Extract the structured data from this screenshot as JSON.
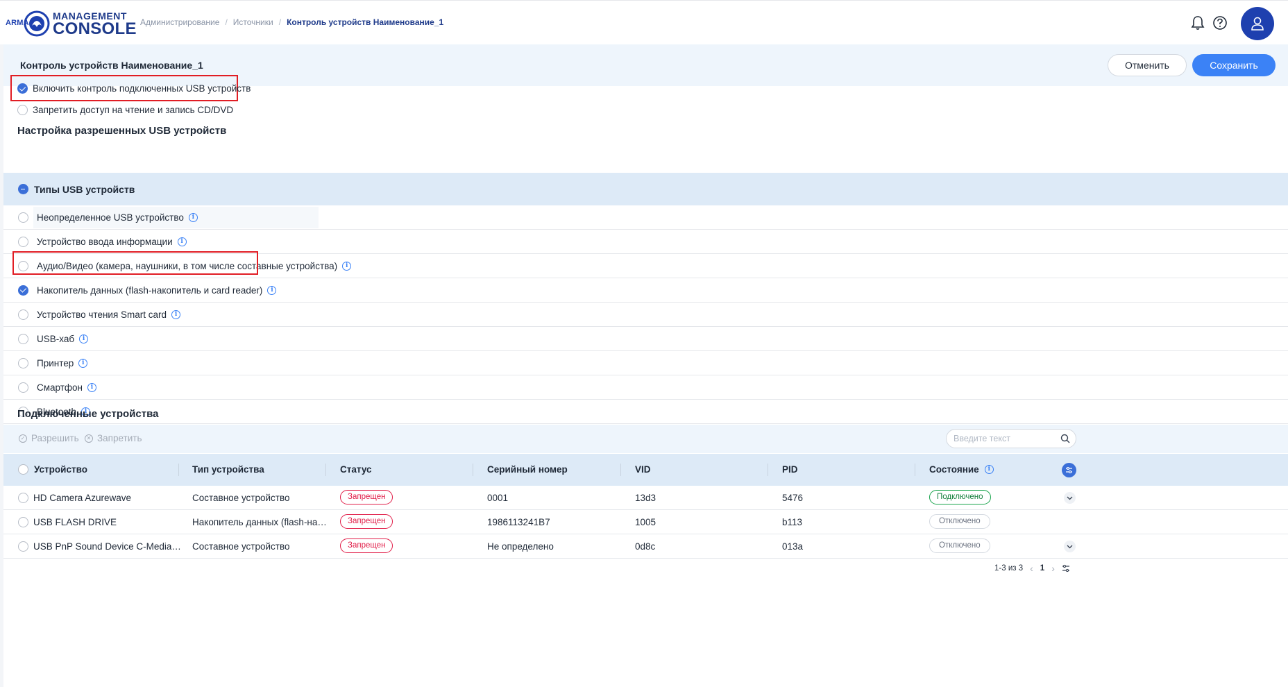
{
  "header": {
    "logo_arma": "ARMA",
    "logo_management": "MANAGEMENT",
    "logo_console": "CONSOLE",
    "breadcrumb": [
      "Администрирование",
      "Источники",
      "Контроль устройств Наименование_1"
    ]
  },
  "page": {
    "title": "Контроль устройств Наименование_1",
    "cancel_label": "Отменить",
    "save_label": "Сохранить"
  },
  "options": {
    "enable_usb_control": {
      "label": "Включить контроль подключенных USB устройств",
      "checked": true
    },
    "block_cd_dvd": {
      "label": "Запретить доступ на чтение и запись CD/DVD",
      "checked": false
    }
  },
  "usb_settings": {
    "title": "Настройка разрешенных USB устройств",
    "group_label": "Типы USB устройств",
    "types": [
      {
        "label": "Неопределенное USB устройство",
        "checked": false
      },
      {
        "label": "Устройство ввода информации",
        "checked": false
      },
      {
        "label": "Аудио/Видео (камера, наушники, в том числе составные устройства)",
        "checked": false
      },
      {
        "label": "Накопитель данных (flash-накопитель и card reader)",
        "checked": true
      },
      {
        "label": "Устройство чтения Smart card",
        "checked": false
      },
      {
        "label": "USB-хаб",
        "checked": false
      },
      {
        "label": "Принтер",
        "checked": false
      },
      {
        "label": "Смартфон",
        "checked": false
      },
      {
        "label": "Bluetooth",
        "checked": false
      }
    ]
  },
  "devices": {
    "title": "Подключенные устройства",
    "allow_label": "Разрешить",
    "deny_label": "Запретить",
    "search_placeholder": "Введите текст",
    "columns": [
      "Устройство",
      "Тип устройства",
      "Статус",
      "Серийный номер",
      "VID",
      "PID",
      "Состояние"
    ],
    "rows": [
      {
        "device": "HD Camera Azurewave",
        "type": "Составное устройство",
        "status": "Запрещен",
        "serial": "0001",
        "vid": "13d3",
        "pid": "5476",
        "state": "Подключено",
        "state_kind": "connected",
        "expandable": true
      },
      {
        "device": "USB FLASH DRIVE",
        "type": "Накопитель данных (flash-на…",
        "status": "Запрещен",
        "serial": "1986113241B7",
        "vid": "1005",
        "pid": "b113",
        "state": "Отключено",
        "state_kind": "disconnected",
        "expandable": false
      },
      {
        "device": "USB PnP Sound Device C-Media…",
        "type": "Составное устройство",
        "status": "Запрещен",
        "serial": "Не определено",
        "vid": "0d8c",
        "pid": "013a",
        "state": "Отключено",
        "state_kind": "disconnected",
        "expandable": true
      }
    ],
    "pager": {
      "range": "1-3 из 3",
      "page": "1"
    }
  },
  "colors": {
    "accent": "#3b82f6",
    "brand": "#1e3a8a",
    "danger": "#e11d48",
    "success": "#16a34a",
    "highlight": "#e11d24"
  }
}
